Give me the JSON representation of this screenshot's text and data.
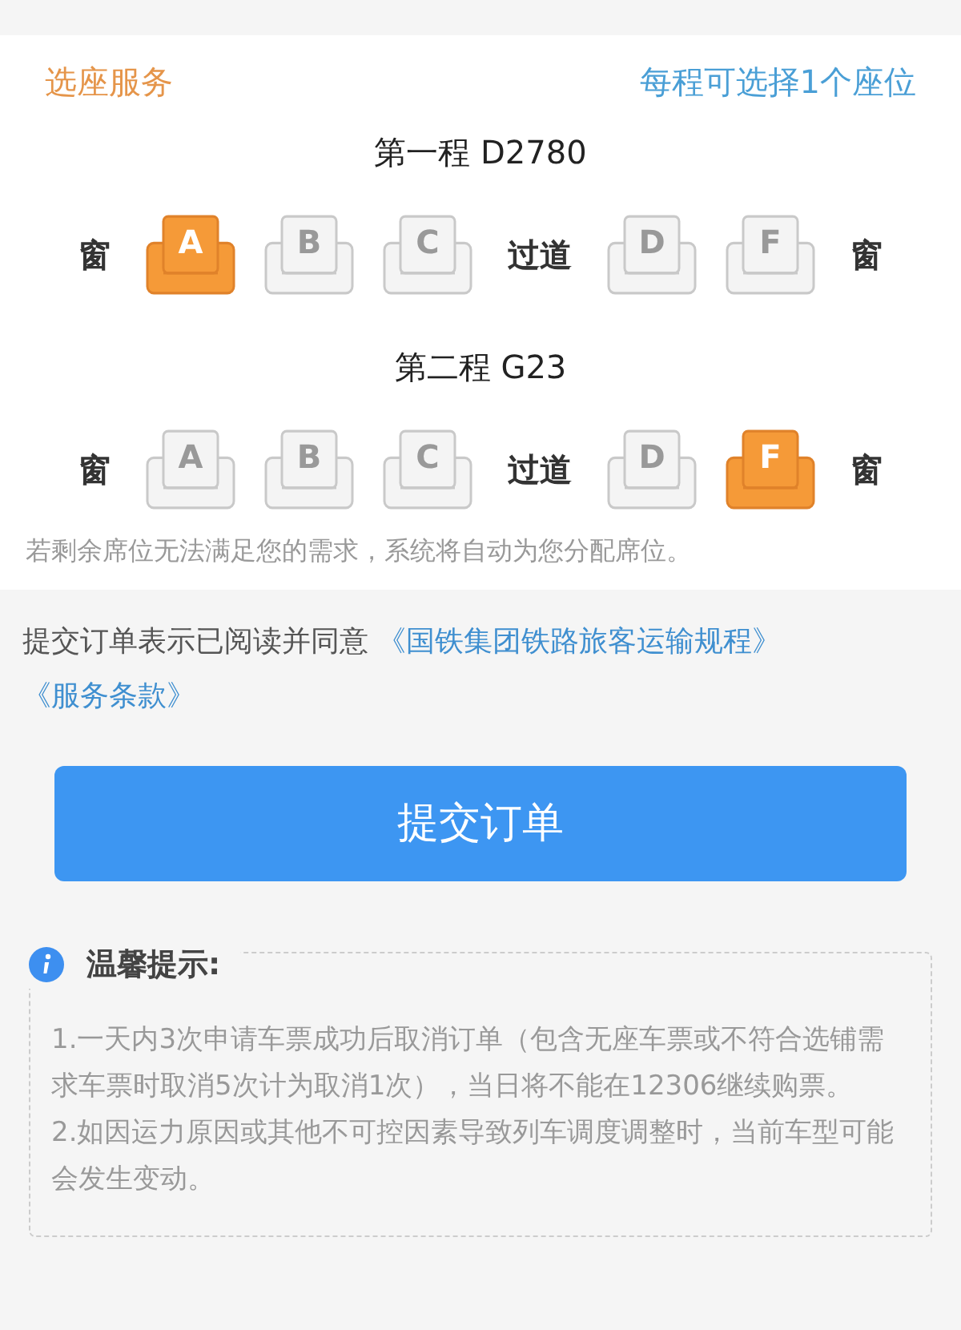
{
  "seat_service": {
    "title": "选座服务",
    "hint": "每程可选择1个座位",
    "legs": [
      {
        "title": "第一程 D2780",
        "row": [
          {
            "kind": "label",
            "text": "窗"
          },
          {
            "kind": "seat",
            "letter": "A",
            "selected": true
          },
          {
            "kind": "seat",
            "letter": "B",
            "selected": false
          },
          {
            "kind": "seat",
            "letter": "C",
            "selected": false
          },
          {
            "kind": "label",
            "text": "过道"
          },
          {
            "kind": "seat",
            "letter": "D",
            "selected": false
          },
          {
            "kind": "seat",
            "letter": "F",
            "selected": false
          },
          {
            "kind": "label",
            "text": "窗"
          }
        ]
      },
      {
        "title": "第二程 G23",
        "row": [
          {
            "kind": "label",
            "text": "窗"
          },
          {
            "kind": "seat",
            "letter": "A",
            "selected": false
          },
          {
            "kind": "seat",
            "letter": "B",
            "selected": false
          },
          {
            "kind": "seat",
            "letter": "C",
            "selected": false
          },
          {
            "kind": "label",
            "text": "过道"
          },
          {
            "kind": "seat",
            "letter": "D",
            "selected": false
          },
          {
            "kind": "seat",
            "letter": "F",
            "selected": true
          },
          {
            "kind": "label",
            "text": "窗"
          }
        ]
      }
    ],
    "note": "若剩余席位无法满足您的需求，系统将自动为您分配席位。"
  },
  "agreement": {
    "text": "提交订单表示已阅读并同意",
    "links": [
      "《国铁集团铁路旅客运输规程》",
      "《服务条款》"
    ]
  },
  "submit_button": "提交订单",
  "tips": {
    "title": "温馨提示:",
    "items": [
      "1.一天内3次申请车票成功后取消订单（包含无座车票或不符合选铺需求车票时取消5次计为取消1次），当日将不能在12306继续购票。",
      "2.如因运力原因或其他不可控因素导致列车调度调整时，当前车型可能会发生变动。"
    ]
  }
}
